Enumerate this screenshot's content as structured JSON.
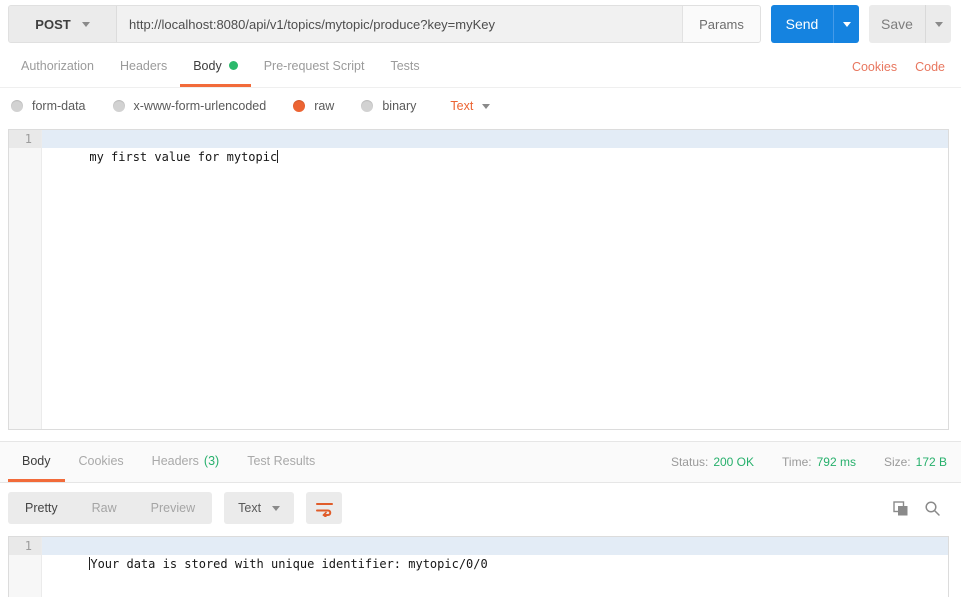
{
  "request_bar": {
    "method": "POST",
    "url": "http://localhost:8080/api/v1/topics/mytopic/produce?key=myKey",
    "params_label": "Params",
    "send_label": "Send",
    "save_label": "Save"
  },
  "request_tabs": {
    "items": [
      {
        "label": "Authorization"
      },
      {
        "label": "Headers"
      },
      {
        "label": "Body"
      },
      {
        "label": "Pre-request Script"
      },
      {
        "label": "Tests"
      }
    ],
    "active_tab": "Body",
    "cookies_link": "Cookies",
    "code_link": "Code"
  },
  "body_type": {
    "options": [
      "form-data",
      "x-www-form-urlencoded",
      "raw",
      "binary"
    ],
    "selected": "raw",
    "format_label": "Text"
  },
  "request_editor": {
    "line_number": "1",
    "line_text": "my first value for mytopic"
  },
  "response": {
    "tabs": [
      "Body",
      "Cookies",
      "Headers",
      "Test Results"
    ],
    "active_tab": "Body",
    "headers_count": "(3)",
    "status_label": "Status:",
    "status_value": "200 OK",
    "time_label": "Time:",
    "time_value": "792 ms",
    "size_label": "Size:",
    "size_value": "172 B",
    "view_modes": [
      "Pretty",
      "Raw",
      "Preview"
    ],
    "active_view_mode": "Pretty",
    "format_label": "Text",
    "editor": {
      "line_number": "1",
      "line_text": "Your data is stored with unique identifier: mytopic/0/0"
    }
  },
  "icons": {
    "caret_down": "css-triangle-down",
    "body_status_dot": "green-circle",
    "wrap_lines": "orange-wrap-arrow",
    "copy": "overlapping-squares",
    "search": "magnifying-glass"
  },
  "colors": {
    "accent_orange": "#f26b3a",
    "link_orange": "#e8775f",
    "radio_selected_orange": "#ec6433",
    "status_green": "#27b06c",
    "body_dot_green": "#2cb96c",
    "send_blue": "#1583e0",
    "active_line_highlight": "#e3ecf6"
  }
}
